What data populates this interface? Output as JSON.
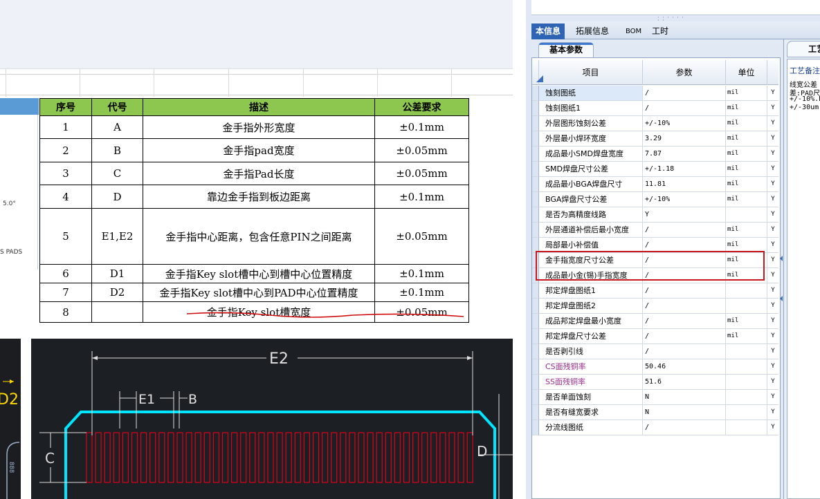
{
  "tolerance_table": {
    "headers": [
      "序号",
      "代号",
      "描述",
      "公差要求"
    ],
    "rows": [
      {
        "no": "1",
        "code": "A",
        "desc": "金手指外形宽度",
        "tol": "±0.1mm"
      },
      {
        "no": "2",
        "code": "B",
        "desc": "金手指pad宽度",
        "tol": "±0.05mm"
      },
      {
        "no": "3",
        "code": "C",
        "desc": "金手指Pad长度",
        "tol": "±0.05mm"
      },
      {
        "no": "4",
        "code": "D",
        "desc": "靠边金手指到板边距离",
        "tol": "±0.1mm"
      },
      {
        "no": "5",
        "code": "E1,E2",
        "desc": "金手指中心距离，包含任意PIN之间距离",
        "tol": "±0.05mm"
      },
      {
        "no": "6",
        "code": "D1",
        "desc": "金手指Key slot槽中心到槽中心位置精度",
        "tol": "±0.1mm"
      },
      {
        "no": "7",
        "code": "D2",
        "desc": "金手指Key slot槽中心到PAD中心位置精度",
        "tol": "±0.1mm"
      },
      {
        "no": "8",
        "code": "",
        "desc": "金手指Key slot槽宽度",
        "tol": "±0.05mm"
      }
    ]
  },
  "left_notes": {
    "note1": "5.0°",
    "note2": "S PADS"
  },
  "cad": {
    "label_e2": "E2",
    "label_e1": "E1",
    "label_b": "B",
    "label_c": "C",
    "label_d": "D",
    "label_d2": "D2",
    "colors": {
      "outline": "#00e5ff",
      "pads": "#e0001a",
      "dims": "#ffffff"
    }
  },
  "app": {
    "tabs": [
      "本信息",
      "拓展信息",
      "BOM",
      "工时"
    ],
    "subtab": "基本参数",
    "grid": {
      "headers": {
        "item": "项目",
        "param": "参数",
        "unit": "单位"
      },
      "rows": [
        {
          "item": "蚀刻图纸",
          "param": "/",
          "unit": "mil",
          "flag": "Y"
        },
        {
          "item": "蚀刻图纸1",
          "param": "/",
          "unit": "mil",
          "flag": "Y"
        },
        {
          "item": "外层图形蚀刻公差",
          "param": "+/-10%",
          "unit": "mil",
          "flag": "Y"
        },
        {
          "item": "外层最小焊环宽度",
          "param": "3.29",
          "unit": "mil",
          "flag": "Y"
        },
        {
          "item": "成品最小SMD焊盘宽度",
          "param": "7.87",
          "unit": "mil",
          "flag": "Y"
        },
        {
          "item": "SMD焊盘尺寸公差",
          "param": "+/-1.18",
          "unit": "mil",
          "flag": "Y"
        },
        {
          "item": "成品最小BGA焊盘尺寸",
          "param": "11.81",
          "unit": "mil",
          "flag": "Y"
        },
        {
          "item": "BGA焊盘尺寸公差",
          "param": "+/-10%",
          "unit": "mil",
          "flag": "Y"
        },
        {
          "item": "是否为高精度线路",
          "param": "Y",
          "unit": "",
          "flag": "Y"
        },
        {
          "item": "外层通道补偿后最小宽度",
          "param": "/",
          "unit": "mil",
          "flag": "Y"
        },
        {
          "item": "局部最小补偿值",
          "param": "/",
          "unit": "mil",
          "flag": "Y"
        },
        {
          "item": "金手指宽度尺寸公差",
          "param": "/",
          "unit": "mil",
          "flag": "Y"
        },
        {
          "item": "成品最小金(锡)手指宽度",
          "param": "/",
          "unit": "mil",
          "flag": "Y"
        },
        {
          "item": "邦定焊盘图纸1",
          "param": "/",
          "unit": "",
          "flag": "Y"
        },
        {
          "item": "邦定焊盘图纸2",
          "param": "/",
          "unit": "",
          "flag": "Y"
        },
        {
          "item": "成品邦定焊盘最小宽度",
          "param": "/",
          "unit": "mil",
          "flag": "Y"
        },
        {
          "item": "邦定焊盘尺寸公差",
          "param": "/",
          "unit": "mil",
          "flag": "Y"
        },
        {
          "item": "是否剥引线",
          "param": "/",
          "unit": "",
          "flag": "Y"
        },
        {
          "item": "CS面残铜率",
          "param": "50.46",
          "unit": "",
          "flag": "Y"
        },
        {
          "item": "SS面残铜率",
          "param": "51.6",
          "unit": "",
          "flag": "Y"
        },
        {
          "item": "是否单面蚀刻",
          "param": "N",
          "unit": "",
          "flag": "Y"
        },
        {
          "item": "是否有缝宽要求",
          "param": "N",
          "unit": "",
          "flag": "Y"
        },
        {
          "item": "分流线图纸",
          "param": "/",
          "unit": "",
          "flag": "Y"
        }
      ]
    },
    "side_panel": {
      "tab": "工艺",
      "title": "工艺备注",
      "lines": [
        "线宽公差",
        "差:PAD尺",
        "+/-10%.P",
        "+/-30um"
      ]
    }
  }
}
